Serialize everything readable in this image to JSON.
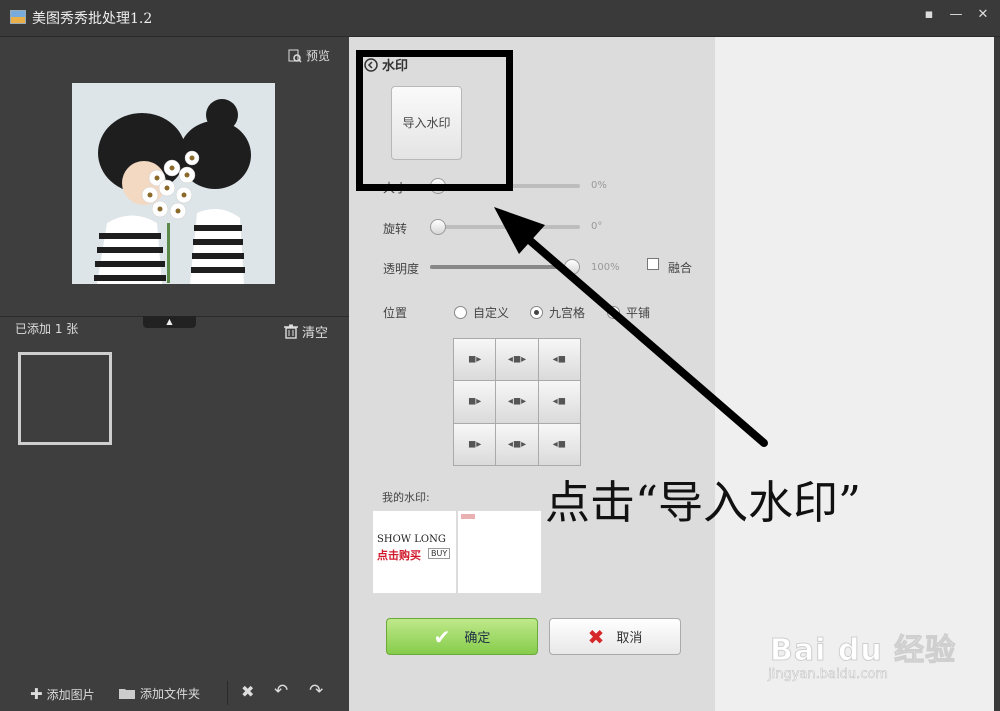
{
  "titlebar": {
    "title": "美图秀秀批处理1.2",
    "controls": [
      "▪",
      "—",
      "✕"
    ]
  },
  "left": {
    "preview_label": "预览",
    "added_label": "已添加 1 张",
    "clear_label": "清空",
    "bottom": {
      "add_image": "添加图片",
      "add_folder": "添加文件夹"
    }
  },
  "panel": {
    "back_label": "水印",
    "import_button": "导入水印",
    "size_label": "大小",
    "size_value": "0%",
    "size_level": 0,
    "rotate_label": "旋转",
    "rotate_value": "0°",
    "rotate_level": 0,
    "opacity_label": "透明度",
    "opacity_value": "100%",
    "opacity_level": 1,
    "blend_label": "融合",
    "position_label": "位置",
    "position_options": [
      "自定义",
      "九宫格",
      "平铺"
    ],
    "position_selected": "九宫格",
    "my_watermarks_label": "我的水印:",
    "wm_line1": "SHOW  LONG",
    "wm_line2": "点击购买",
    "wm_buy": "BUY",
    "ok_label": "确定",
    "cancel_label": "取消"
  },
  "annotation": {
    "caption": "点击“导入水印”"
  },
  "brand": {
    "logo_text": "Bai du 经验",
    "url": "jingyan.baidu.com"
  },
  "colors": {
    "accent_green": "#86cc4c",
    "cancel_red": "#d62828",
    "annotation": "#000000"
  }
}
